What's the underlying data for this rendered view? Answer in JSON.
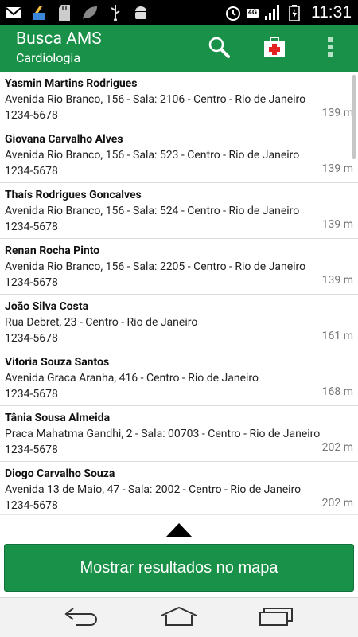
{
  "status_bar": {
    "time": "11:31",
    "network": "4G",
    "icons": [
      "gmail-icon",
      "clean-master-icon",
      "sd-card-icon",
      "leaf-icon",
      "usb-icon",
      "android-debug-icon",
      "alarm-icon",
      "signal-icon",
      "battery-charging-icon"
    ]
  },
  "action_bar": {
    "title": "Busca AMS",
    "subtitle": "Cardiologia",
    "actions": [
      "search-icon",
      "first-aid-kit-icon",
      "overflow-menu-icon"
    ]
  },
  "results": [
    {
      "name": "Yasmin Martins Rodrigues",
      "address": "Avenida Rio Branco, 156 - Sala: 2106 - Centro - Rio de Janeiro",
      "phone": "1234-5678",
      "distance": "139 m"
    },
    {
      "name": "Giovana Carvalho Alves",
      "address": "Avenida Rio Branco, 156 - Sala: 523 - Centro - Rio de Janeiro",
      "phone": "1234-5678",
      "distance": "139 m"
    },
    {
      "name": "Thaís Rodrigues Goncalves",
      "address": "Avenida Rio Branco, 156 - Sala: 524 - Centro - Rio de Janeiro",
      "phone": "1234-5678",
      "distance": "139 m"
    },
    {
      "name": "Renan Rocha Pinto",
      "address": "Avenida Rio Branco, 156 - Sala: 2205 - Centro - Rio de Janeiro",
      "phone": "1234-5678",
      "distance": "139 m"
    },
    {
      "name": "João Silva Costa",
      "address": "Rua Debret, 23 - Centro - Rio de Janeiro",
      "phone": "1234-5678",
      "distance": "161 m"
    },
    {
      "name": "Vitoria Souza Santos",
      "address": "Avenida Graca Aranha, 416 - Centro - Rio de Janeiro",
      "phone": "1234-5678",
      "distance": "168 m"
    },
    {
      "name": "Tânia Sousa Almeida",
      "address": "Praca Mahatma Gandhi, 2 - Sala: 00703 - Centro - Rio de Janeiro",
      "phone": "1234-5678",
      "distance": "202 m"
    },
    {
      "name": "Diogo Carvalho Souza",
      "address": "Avenida 13 de Maio, 47 - Sala: 2002 - Centro - Rio de Janeiro",
      "phone": "1234-5678",
      "distance": "202 m"
    }
  ],
  "bottom": {
    "map_button_label": "Mostrar resultados no mapa"
  },
  "nav_bar": {
    "buttons": [
      "back-icon",
      "home-icon",
      "recent-apps-icon"
    ]
  },
  "colors": {
    "accent": "#1a9148",
    "status_bar": "#000000",
    "nav_bar": "#f2f2f2"
  }
}
